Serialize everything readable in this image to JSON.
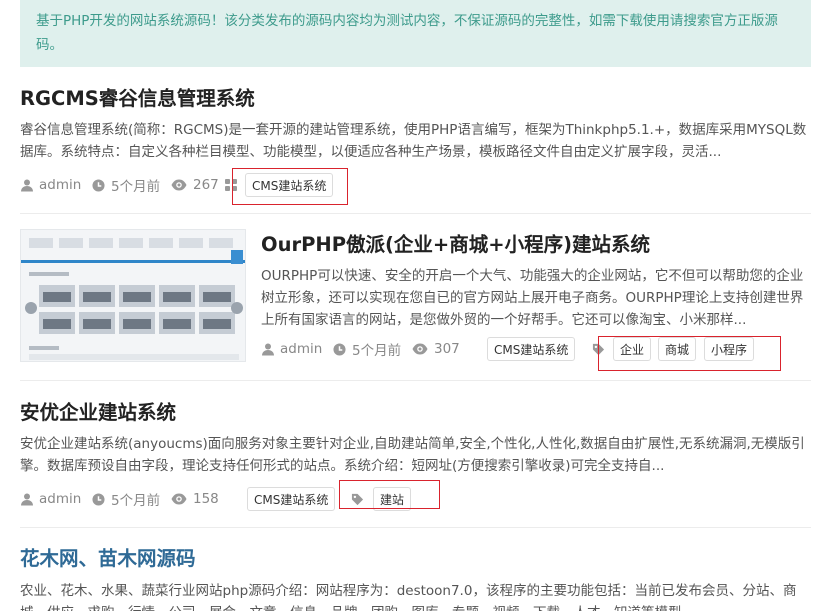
{
  "notice": "基于PHP开发的网站系统源码！该分类发布的源码内容均为测试内容，不保证源码的完整性，如需下载使用请搜索官方正版源码。",
  "posts": [
    {
      "title": "RGCMS睿谷信息管理系统",
      "excerpt": "睿谷信息管理系统(简称：RGCMS)是一套开源的建站管理系统，使用PHP语言编写，框架为Thinkphp5.1.+，数据库采用MYSQL数据库。系统特点：自定义各种栏目模型、功能模型，以便适应各种生产场景，模板路径文件自由定义扩展字段，灵活...",
      "author": "admin",
      "time": "5个月前",
      "views": "267",
      "category": "CMS建站系统",
      "tags": []
    },
    {
      "title": "OurPHP傲派(企业+商城+小程序)建站系统",
      "excerpt": "OURPHP可以快速、安全的开启一个大气、功能强大的企业网站，它不但可以帮助您的企业树立形象，还可以实现在您自已的官方网站上展开电子商务。OURPHP理论上支持创建世界上所有国家语言的网站，是您做外贸的一个好帮手。它还可以像淘宝、小米那样...",
      "author": "admin",
      "time": "5个月前",
      "views": "307",
      "category": "CMS建站系统",
      "tags": [
        "企业",
        "商城",
        "小程序"
      ]
    },
    {
      "title": "安优企业建站系统",
      "excerpt": "安优企业建站系统(anyoucms)面向服务对象主要针对企业,自助建站简单,安全,个性化,人性化,数据自由扩展性,无系统漏洞,无模版引擎。数据库预设自由字段，理论支持任何形式的站点。系统介绍：短网址(方便搜索引擎收录)可完全支持自...",
      "author": "admin",
      "time": "5个月前",
      "views": "158",
      "category": "CMS建站系统",
      "tags": [
        "建站"
      ]
    },
    {
      "title": "花木网、苗木网源码",
      "excerpt": "农业、花木、水果、蔬菜行业网站php源码介绍：网站程序为：destoon7.0，该程序的主要功能包括：当前已发布会员、分站、商城、供应、求购、行情、公司、展会、文章、信息、品牌、团购、图库、专题、视频、下载、人才、知道等模型。"
    }
  ],
  "colors": {
    "notice_bg": "#dff0ed",
    "notice_text": "#3d9b8c",
    "title_link": "#2f6a96",
    "highlight_box": "#d9232d"
  },
  "icons": {
    "author": "user-icon",
    "time": "clock-icon",
    "views": "eye-icon",
    "category": "grid-icon",
    "tags": "tag-icon"
  }
}
